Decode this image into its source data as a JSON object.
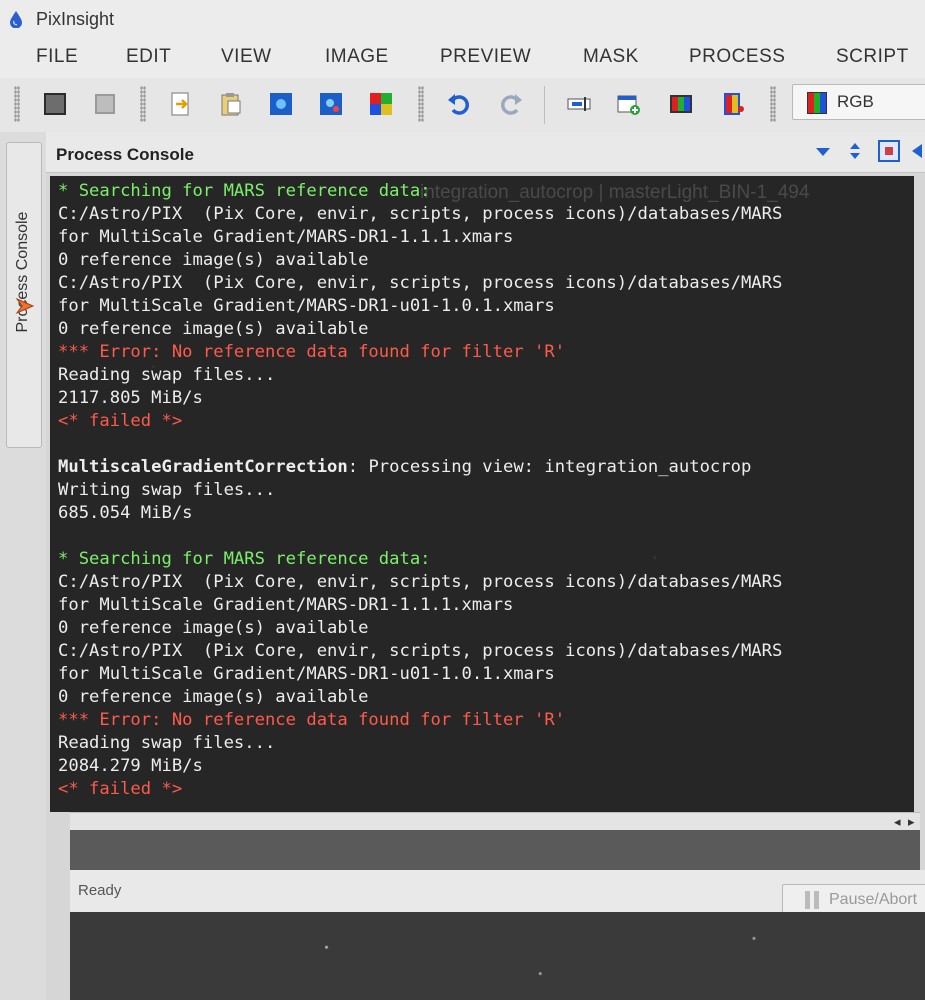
{
  "window": {
    "title": "PixInsight"
  },
  "menu": {
    "items": [
      "FILE",
      "EDIT",
      "VIEW",
      "IMAGE",
      "PREVIEW",
      "MASK",
      "PROCESS",
      "SCRIPT"
    ]
  },
  "toolbar": {
    "channel_select": {
      "value": "RGB"
    }
  },
  "dock": {
    "tab_label": "Process Console"
  },
  "panel": {
    "title": "Process Console",
    "background_ghost_text": "integration_autocrop | masterLight_BIN-1_494"
  },
  "console": {
    "lines": [
      {
        "text": "* Searching for MARS reference data:",
        "kind": "info"
      },
      {
        "text": "C:/Astro/PIX  (Pix Core, envir, scripts, process icons)/databases/MARS",
        "kind": "plain"
      },
      {
        "text": "for MultiScale Gradient/MARS-DR1-1.1.1.xmars",
        "kind": "plain"
      },
      {
        "text": "0 reference image(s) available",
        "kind": "plain"
      },
      {
        "text": "C:/Astro/PIX  (Pix Core, envir, scripts, process icons)/databases/MARS",
        "kind": "plain"
      },
      {
        "text": "for MultiScale Gradient/MARS-DR1-u01-1.0.1.xmars",
        "kind": "plain"
      },
      {
        "text": "0 reference image(s) available",
        "kind": "plain"
      },
      {
        "text": "*** Error: No reference data found for filter 'R'",
        "kind": "error"
      },
      {
        "text": "Reading swap files...",
        "kind": "plain"
      },
      {
        "text": "2117.805 MiB/s",
        "kind": "plain"
      },
      {
        "text": "<* failed *>",
        "kind": "error"
      },
      {
        "text": "",
        "kind": "blank"
      },
      {
        "text": "MultiscaleGradientCorrection",
        "suffix": ": Processing view: integration_autocrop",
        "kind": "bold"
      },
      {
        "text": "Writing swap files...",
        "kind": "plain"
      },
      {
        "text": "685.054 MiB/s",
        "kind": "plain"
      },
      {
        "text": "",
        "kind": "blank"
      },
      {
        "text": "* Searching for MARS reference data:",
        "kind": "info"
      },
      {
        "text": "C:/Astro/PIX  (Pix Core, envir, scripts, process icons)/databases/MARS",
        "kind": "plain"
      },
      {
        "text": "for MultiScale Gradient/MARS-DR1-1.1.1.xmars",
        "kind": "plain"
      },
      {
        "text": "0 reference image(s) available",
        "kind": "plain"
      },
      {
        "text": "C:/Astro/PIX  (Pix Core, envir, scripts, process icons)/databases/MARS",
        "kind": "plain"
      },
      {
        "text": "for MultiScale Gradient/MARS-DR1-u01-1.0.1.xmars",
        "kind": "plain"
      },
      {
        "text": "0 reference image(s) available",
        "kind": "plain"
      },
      {
        "text": "*** Error: No reference data found for filter 'R'",
        "kind": "error"
      },
      {
        "text": "Reading swap files...",
        "kind": "plain"
      },
      {
        "text": "2084.279 MiB/s",
        "kind": "plain"
      },
      {
        "text": "<* failed *>",
        "kind": "error"
      }
    ]
  },
  "status": {
    "text": "Ready",
    "abort_button": "Pause/Abort"
  },
  "colors": {
    "info": "#7cf06a",
    "error": "#ff5a4a",
    "console_bg": "#262626",
    "accent": "#2a6fd6"
  },
  "icons": {
    "app_logo": "droplet-icon",
    "dock_tab_icon": "process-arrow-icon",
    "panel_header": [
      "collapse-down-icon",
      "resize-vertical-icon",
      "float-panel-icon",
      "close-panel-icon"
    ]
  }
}
